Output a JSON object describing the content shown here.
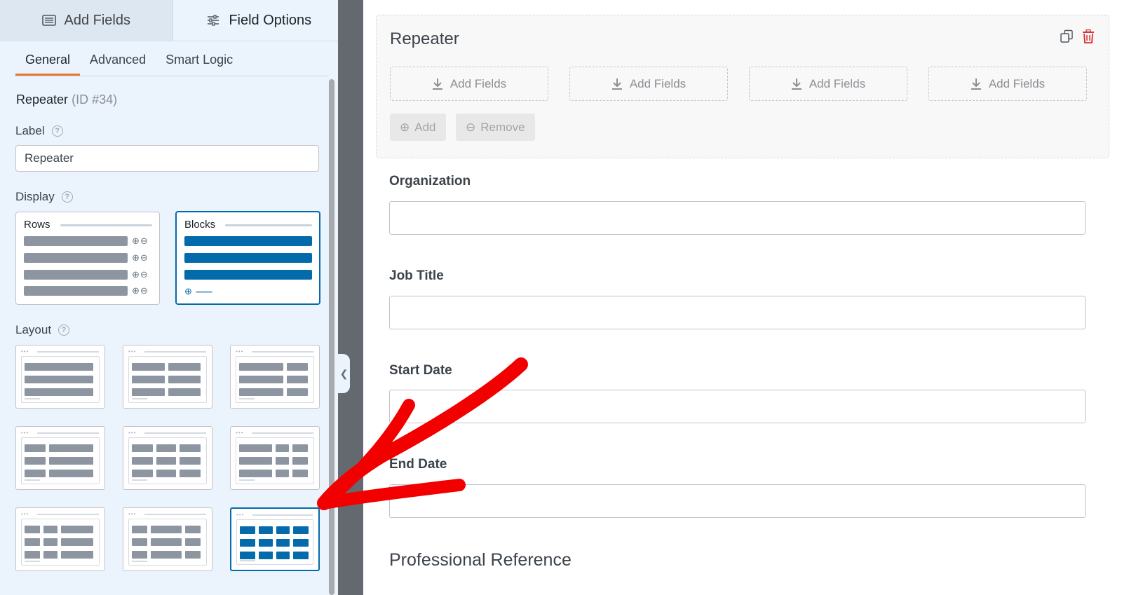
{
  "sidebar": {
    "tabs": [
      {
        "label": "Add Fields",
        "icon": "list-icon",
        "active": false
      },
      {
        "label": "Field Options",
        "icon": "sliders-icon",
        "active": true
      }
    ],
    "subtabs": [
      "General",
      "Advanced",
      "Smart Logic"
    ],
    "active_subtab": "General",
    "field": {
      "type": "Repeater",
      "id": "(ID #34)"
    },
    "label_label": "Label",
    "label_value": "Repeater",
    "display_label": "Display",
    "display_options": [
      {
        "title": "Rows",
        "selected": false
      },
      {
        "title": "Blocks",
        "selected": true
      }
    ],
    "layout_label": "Layout",
    "selected_layout": 9
  },
  "preview": {
    "repeater": {
      "title": "Repeater",
      "add_fields_labels": [
        "Add Fields",
        "Add Fields",
        "Add Fields",
        "Add Fields"
      ],
      "add_button": "Add",
      "remove_button": "Remove"
    },
    "fields": [
      {
        "label": "Organization"
      },
      {
        "label": "Job Title"
      },
      {
        "label": "Start Date"
      },
      {
        "label": "End Date"
      }
    ],
    "section_title": "Professional Reference"
  },
  "colors": {
    "accent_blue": "#036aab",
    "tab_underline": "#e27730",
    "arrow_red": "#f20000",
    "delete_red": "#d63638"
  }
}
